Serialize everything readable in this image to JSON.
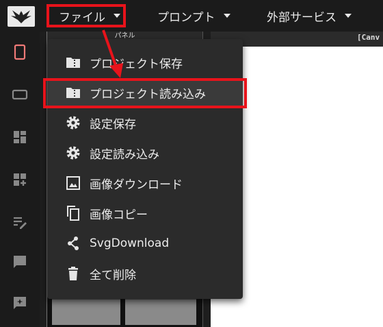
{
  "menubar": {
    "file_label": "ファイル",
    "prompt_label": "プロンプト",
    "external_label": "外部サービス"
  },
  "panel": {
    "title": "パネル"
  },
  "canvas": {
    "label": "[Canv"
  },
  "file_menu": {
    "items": [
      {
        "label": "プロジェクト保存",
        "icon": "folder-zip-icon"
      },
      {
        "label": "プロジェクト読み込み",
        "icon": "folder-zip-icon"
      },
      {
        "label": "設定保存",
        "icon": "gear-icon"
      },
      {
        "label": "設定読み込み",
        "icon": "gear-icon"
      },
      {
        "label": "画像ダウンロード",
        "icon": "image-icon"
      },
      {
        "label": "画像コピー",
        "icon": "copy-icon"
      },
      {
        "label": "SvgDownload",
        "icon": "share-nodes-icon"
      },
      {
        "label": "全て削除",
        "icon": "trash-icon"
      }
    ]
  },
  "colors": {
    "highlight": "#e8131b",
    "accent_icon": "#f07a78",
    "menu_bg": "#2b2b2b",
    "topbar_bg": "#1b1b1b"
  }
}
